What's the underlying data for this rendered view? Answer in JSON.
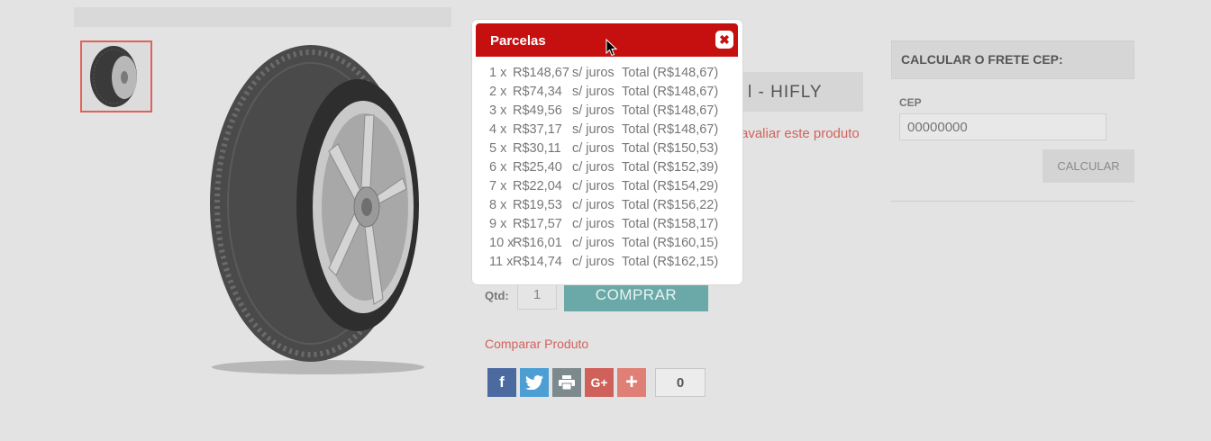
{
  "product": {
    "title_fragment": "l - HIFLY",
    "review_link": "avaliar este produto",
    "qty_label": "Qtd:",
    "qty_value": "1",
    "buy_label": "COMPRAR",
    "compare_link": "Comparar Produto",
    "share_count": "0"
  },
  "freight": {
    "title": "CALCULAR O FRETE CEP:",
    "cep_label": "CEP",
    "cep_placeholder": "00000000",
    "calc_label": "CALCULAR"
  },
  "modal": {
    "title": "Parcelas",
    "close_icon": "close-icon",
    "rows": [
      {
        "n": "1 x",
        "value": "R$148,67",
        "juros": "s/ juros",
        "total": "Total (R$148,67)"
      },
      {
        "n": "2 x",
        "value": "R$74,34",
        "juros": "s/ juros",
        "total": "Total (R$148,67)"
      },
      {
        "n": "3 x",
        "value": "R$49,56",
        "juros": "s/ juros",
        "total": "Total (R$148,67)"
      },
      {
        "n": "4 x",
        "value": "R$37,17",
        "juros": "s/ juros",
        "total": "Total (R$148,67)"
      },
      {
        "n": "5 x",
        "value": "R$30,11",
        "juros": "c/ juros",
        "total": "Total (R$150,53)"
      },
      {
        "n": "6 x",
        "value": "R$25,40",
        "juros": "c/ juros",
        "total": "Total (R$152,39)"
      },
      {
        "n": "7 x",
        "value": "R$22,04",
        "juros": "c/ juros",
        "total": "Total (R$154,29)"
      },
      {
        "n": "8 x",
        "value": "R$19,53",
        "juros": "c/ juros",
        "total": "Total (R$156,22)"
      },
      {
        "n": "9 x",
        "value": "R$17,57",
        "juros": "c/ juros",
        "total": "Total (R$158,17)"
      },
      {
        "n": "10 x",
        "value": "R$16,01",
        "juros": "c/ juros",
        "total": "Total (R$160,15)"
      },
      {
        "n": "11 x",
        "value": "R$14,74",
        "juros": "c/ juros",
        "total": "Total (R$162,15)"
      }
    ]
  },
  "colors": {
    "modal_header": "#c61010",
    "buy_button": "#6aa9a8",
    "link": "#d2625d"
  }
}
